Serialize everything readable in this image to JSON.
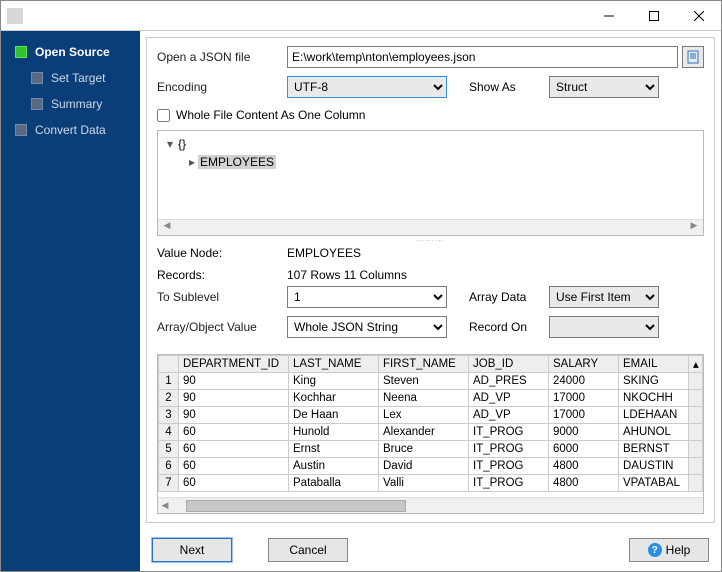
{
  "sidebar": {
    "items": [
      {
        "label": "Open Source",
        "active": true
      },
      {
        "label": "Set Target"
      },
      {
        "label": "Summary"
      },
      {
        "label": "Convert Data"
      }
    ]
  },
  "form": {
    "open_label": "Open a JSON file",
    "file_path": "E:\\work\\temp\\nton\\employees.json",
    "encoding_label": "Encoding",
    "encoding_value": "UTF-8",
    "showas_label": "Show As",
    "showas_value": "Struct",
    "whole_file_label": "Whole File Content As One Column",
    "value_node_label": "Value Node:",
    "value_node": "EMPLOYEES",
    "records_label": "Records:",
    "records_value": "107 Rows    11 Columns",
    "sublevel_label": "To Sublevel",
    "sublevel_value": "1",
    "arraydata_label": "Array Data",
    "arraydata_value": "Use First Item",
    "objval_label": "Array/Object Value",
    "objval_value": "Whole JSON String",
    "recordon_label": "Record On",
    "recordon_value": ""
  },
  "tree": {
    "root": "{}",
    "child": "EMPLOYEES"
  },
  "table": {
    "columns": [
      "DEPARTMENT_ID",
      "LAST_NAME",
      "FIRST_NAME",
      "JOB_ID",
      "SALARY",
      "EMAIL"
    ],
    "rows": [
      [
        "90",
        "King",
        "Steven",
        "AD_PRES",
        "24000",
        "SKING"
      ],
      [
        "90",
        "Kochhar",
        "Neena",
        "AD_VP",
        "17000",
        "NKOCHH"
      ],
      [
        "90",
        "De Haan",
        "Lex",
        "AD_VP",
        "17000",
        "LDEHAAN"
      ],
      [
        "60",
        "Hunold",
        "Alexander",
        "IT_PROG",
        "9000",
        "AHUNOL"
      ],
      [
        "60",
        "Ernst",
        "Bruce",
        "IT_PROG",
        "6000",
        "BERNST"
      ],
      [
        "60",
        "Austin",
        "David",
        "IT_PROG",
        "4800",
        "DAUSTIN"
      ],
      [
        "60",
        "Pataballa",
        "Valli",
        "IT_PROG",
        "4800",
        "VPATABAL"
      ]
    ]
  },
  "buttons": {
    "next": "Next",
    "cancel": "Cancel",
    "help": "Help"
  }
}
